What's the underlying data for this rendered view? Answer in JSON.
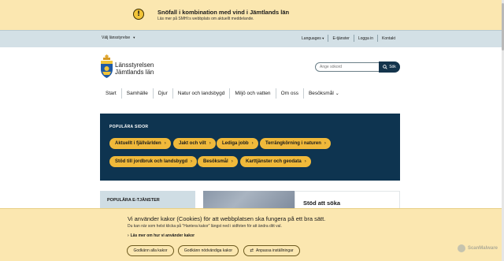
{
  "alert": {
    "icon": "exclamation-icon",
    "title": "Snöfall i kombination med vind i Jämtlands län",
    "text": "Läs mer på SMHI:s webbplats om aktuellt meddelande."
  },
  "utility": {
    "region_label": "Välj länsstyrelse",
    "links": [
      "Languages",
      "E-tjänster",
      "Logga in",
      "Kontakt"
    ]
  },
  "brand": {
    "line1": "Länsstyrelsen",
    "line2": "Jämtlands län"
  },
  "search": {
    "placeholder": "Ange sökord",
    "button_label": "Sök"
  },
  "nav": {
    "items": [
      "Start",
      "Samhälle",
      "Djur",
      "Natur och landsbygd",
      "Miljö och vatten",
      "Om oss",
      "Besöksmål"
    ]
  },
  "popular": {
    "title": "POPULÄRA SIDOR",
    "links": [
      "Aktuellt i fjällvärlden",
      "Jakt och vilt",
      "Lediga jobb",
      "Terrängkörning i naturen",
      "Stöd till jordbruk och landsbygd",
      "Besöksmål",
      "Karttjänster och geodata"
    ]
  },
  "etjanster": {
    "title": "POPULÄRA E-TJÄNSTER"
  },
  "card": {
    "title": "Stöd att söka"
  },
  "cookie": {
    "title": "Vi använder kakor (Cookies) för att webbplatsen ska fungera på ett bra sätt.",
    "text": "Du kan när som helst klicka på \"Hantera kakor\" längst ned i sidfoten för att ändra ditt val.",
    "more_link": "Läs mer om hur vi använder kakor",
    "buttons": [
      "Godkänn alla kakor",
      "Godkänn nödvändiga kakor",
      "Anpassa inställningar"
    ]
  },
  "watermark": "ScanMalware",
  "colors": {
    "alert_bg": "#fbe7b0",
    "utility_bg": "#d3e0e6",
    "navy": "#0e3450",
    "pill": "#f0b93a"
  }
}
